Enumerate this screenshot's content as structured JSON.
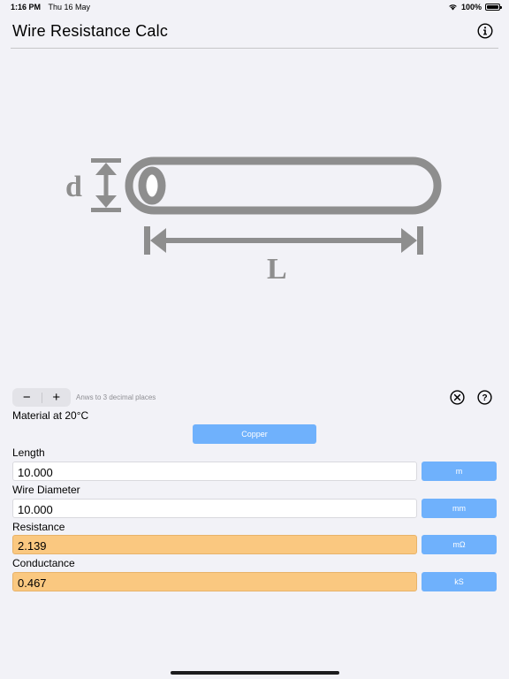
{
  "status_bar": {
    "time": "1:16 PM",
    "date": "Thu 16 May",
    "battery": "100%",
    "wifi_icon": "wifi-icon",
    "battery_icon": "battery-icon"
  },
  "nav": {
    "title": "Wire Resistance Calc",
    "info_icon": "info-icon"
  },
  "diagram": {
    "diameter_label": "d",
    "length_label": "L",
    "color": "#8e8e8e"
  },
  "controls": {
    "decrement_label": "−",
    "increment_label": "+",
    "decimal_note": "Anws to 3 decimal places",
    "clear_icon": "clear-circle-icon",
    "help_icon": "help-circle-icon"
  },
  "material": {
    "label": "Material at 20°C",
    "value": "Copper"
  },
  "fields": {
    "length": {
      "label": "Length",
      "value": "10.000",
      "unit": "m"
    },
    "diameter": {
      "label": "Wire Diameter",
      "value": "10.000",
      "unit": "mm"
    },
    "resistance": {
      "label": "Resistance",
      "value": "2.139",
      "unit": "mΩ"
    },
    "conductance": {
      "label": "Conductance",
      "value": "0.467",
      "unit": "kS"
    }
  },
  "colors": {
    "accent": "#6fb1fc",
    "result": "#fac880",
    "background": "#f2f2f7"
  }
}
